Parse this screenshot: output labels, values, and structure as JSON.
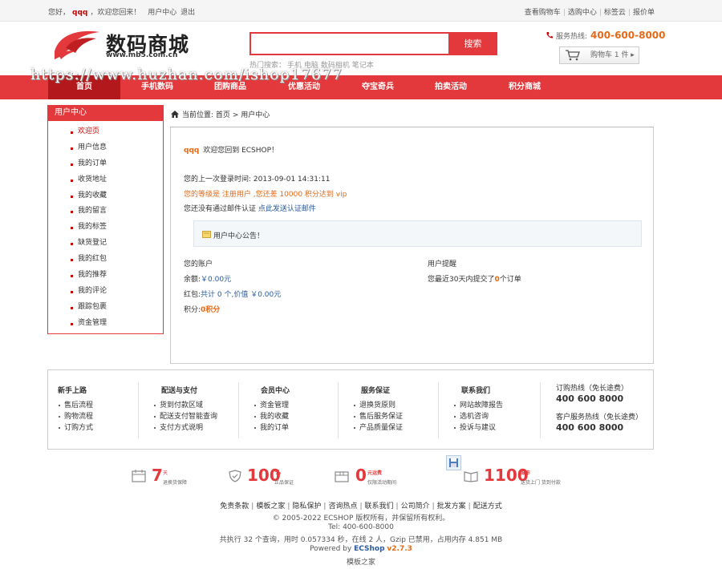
{
  "topbar": {
    "greeting_pre": "您好，",
    "username": "qqq",
    "greeting_post": "，欢迎您回来！",
    "user_center": "用户中心",
    "logout": "退出",
    "right_links": [
      "查看购物车",
      "选购中心",
      "标签云",
      "报价单"
    ]
  },
  "header": {
    "logo_name": "数码商城",
    "logo_url": "www.mb5.com.cn",
    "search_placeholder": "",
    "search_button": "搜索",
    "hot_label": "热门搜索：",
    "hot_words": [
      "手机",
      "电脑",
      "数码相机",
      "笔记本"
    ],
    "hotline_label": "服务热线:",
    "hotline_number": "400-600-8000",
    "cart_label": "购物车 1 件 ▸"
  },
  "nav": {
    "items": [
      "首页",
      "手机数码",
      "团购商品",
      "优惠活动",
      "夺宝奇兵",
      "拍卖活动",
      "积分商城"
    ],
    "active": "首页"
  },
  "watermark": "https://www.huzhan.com/ishop17677",
  "sidebar": {
    "title": "用户中心",
    "items": [
      "欢迎页",
      "用户信息",
      "我的订单",
      "收货地址",
      "我的收藏",
      "我的留言",
      "我的标签",
      "缺货登记",
      "我的红包",
      "我的推荐",
      "我的评论",
      "跟踪包裹",
      "资金管理"
    ],
    "active": "欢迎页"
  },
  "breadcrumb": {
    "label": "当前位置:",
    "home": "首页",
    "sep": ">",
    "current": "用户中心"
  },
  "welcome": {
    "username": "qqq",
    "greeting": "欢迎您回到 ECSHOP！",
    "last_login": "您的上一次登录时间: 2013-09-01 14:31:11",
    "level_text": "您的等级是 注册用户 ,您还差 10000 积分达到 vip",
    "email_text": "您还没有通过邮件认证",
    "email_link": "点此发送认证邮件",
    "notice": "用户中心公告！"
  },
  "account": {
    "title": "您的账户",
    "balance_label": "余额:",
    "balance_value": "￥0.00元",
    "bonus_label": "红包:",
    "bonus_value": "共计 0 个,价值 ￥0.00元",
    "points_label": "积分:",
    "points_value": "0积分"
  },
  "reminder": {
    "title": "用户提醒",
    "text_pre": "您最近30天内提交了",
    "count": "0",
    "text_post": "个订单"
  },
  "help": {
    "columns": [
      {
        "title": "新手上路",
        "items": [
          "售后流程",
          "购物流程",
          "订购方式"
        ]
      },
      {
        "title": "配送与支付",
        "items": [
          "货到付款区域",
          "配送支付智能查询",
          "支付方式说明"
        ]
      },
      {
        "title": "会员中心",
        "items": [
          "资金管理",
          "我的收藏",
          "我的订单"
        ]
      },
      {
        "title": "服务保证",
        "items": [
          "退换货原则",
          "售后服务保证",
          "产品质量保证"
        ]
      },
      {
        "title": "联系我们",
        "items": [
          "网站故障报告",
          "选机咨询",
          "投诉与建议"
        ]
      }
    ],
    "order_hotline_label": "订购热线（免长途费）",
    "order_hotline": "400 600 8000",
    "service_hotline_label": "客户服务热线（免长途费）",
    "service_hotline": "400 600 8000"
  },
  "promises": [
    {
      "big": "7",
      "sub": "天",
      "desc": "退换货保障"
    },
    {
      "big": "100",
      "sub": "%",
      "desc": "正品保证"
    },
    {
      "big": "0",
      "sub": "元运费",
      "desc": "仅限活动期间"
    },
    {
      "big": "1100",
      "sub": "城市",
      "desc": "送货上门 货到付款"
    }
  ],
  "footer": {
    "links": [
      "免责条款",
      "模板之家",
      "隐私保护",
      "咨询热点",
      "联系我们",
      "公司简介",
      "批发方案",
      "配送方式"
    ],
    "copyright": "© 2005-2022 ECSHOP 版权所有，并保留所有权利。",
    "tel": "Tel: 400-600-8000",
    "stats": "共执行 32 个查询，用时 0.057334 秒，在线 2 人，Gzip 已禁用，占用内存 4.851 MB",
    "powered_pre": "Powered by",
    "powered_name": "ECShop",
    "powered_ver": "v2.7.3",
    "template": "模板之家"
  },
  "colors": {
    "brand_red": "#e4393c",
    "accent_orange": "#e46a18",
    "link_blue": "#2a5a9c"
  }
}
